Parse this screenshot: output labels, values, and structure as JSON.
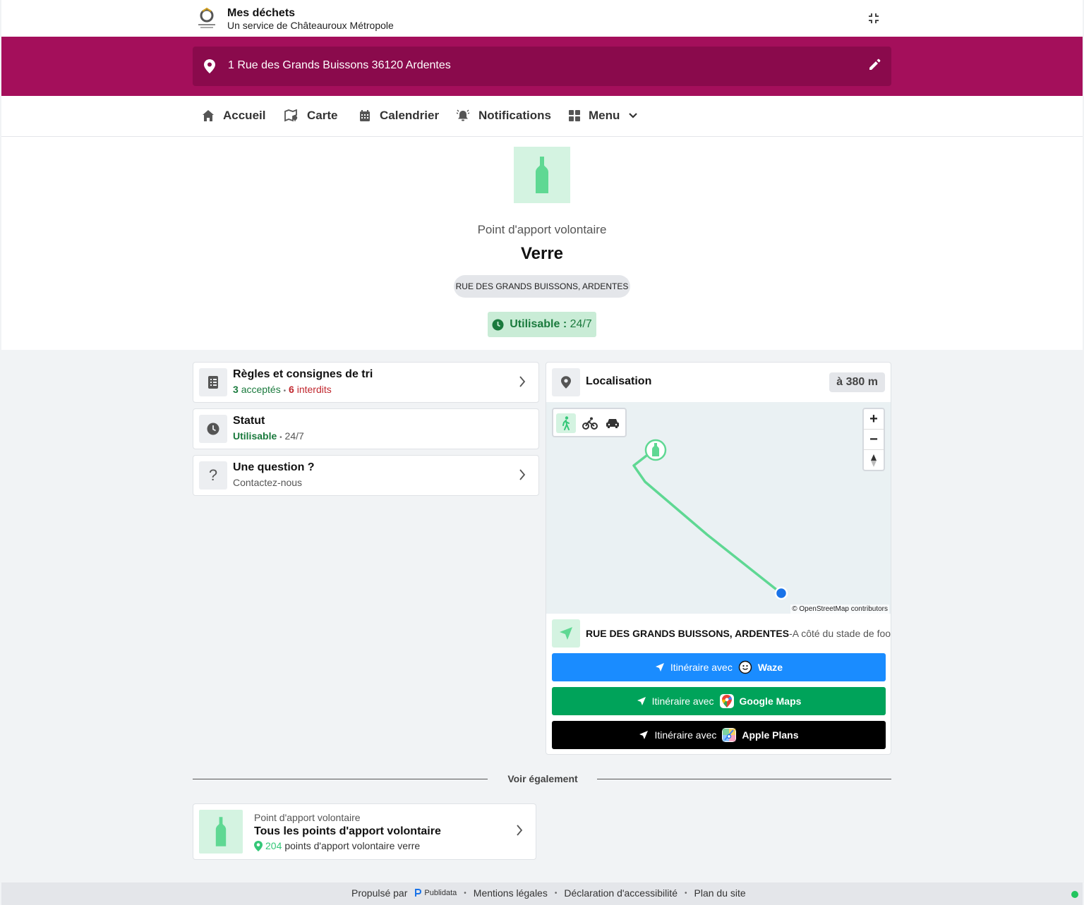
{
  "header": {
    "app_title": "Mes déchets",
    "app_subtitle": "Un service de Châteauroux Métropole",
    "logo_icon": "chateauroux-metropole-logo",
    "collapse_icon": "collapse-icon"
  },
  "address": {
    "text": "1 Rue des Grands Buissons 36120 Ardentes",
    "pin_icon": "map-pin-icon",
    "edit_icon": "pencil-icon"
  },
  "nav": {
    "items": [
      {
        "label": "Accueil",
        "icon": "home-icon"
      },
      {
        "label": "Carte",
        "icon": "map-icon"
      },
      {
        "label": "Calendrier",
        "icon": "calendar-icon"
      },
      {
        "label": "Notifications",
        "icon": "bell-icon"
      },
      {
        "label": "Menu",
        "icon": "grid-icon"
      }
    ]
  },
  "hero": {
    "kind": "Point d'apport volontaire",
    "title": "Verre",
    "location_chip": "RUE DES GRANDS BUISSONS, ARDENTES",
    "status_label": "Utilisable :",
    "status_value": "24/7",
    "icon": "bottle-icon"
  },
  "cards": {
    "rules": {
      "title": "Règles et consignes de tri",
      "accepted_count": "3",
      "accepted_label": "acceptés",
      "separator": "•",
      "forbidden_count": "6",
      "forbidden_label": "interdits"
    },
    "status": {
      "title": "Statut",
      "state": "Utilisable",
      "separator": "•",
      "hours": "24/7"
    },
    "question": {
      "title": "Une question ?",
      "subtitle": "Contactez-nous",
      "icon_glyph": "?"
    }
  },
  "location": {
    "title": "Localisation",
    "distance": "à 380 m",
    "attribution": "© OpenStreetMap contributors",
    "zoom_in": "+",
    "zoom_out": "−",
    "place_name": "RUE DES GRANDS BUISSONS, ARDENTES",
    "place_detail": "-A côté du stade de foot",
    "route_color": "#5fd893",
    "user_dot_color": "#1a73e8"
  },
  "routes": [
    {
      "prefix": "Itinéraire avec",
      "app": "Waze",
      "color": "#1a8cff"
    },
    {
      "prefix": "Itinéraire avec",
      "app": "Google Maps",
      "color": "#00a35a"
    },
    {
      "prefix": "Itinéraire avec",
      "app": "Apple Plans",
      "color": "#000000"
    }
  ],
  "see_also": {
    "heading": "Voir également",
    "item": {
      "kind": "Point d'apport volontaire",
      "title": "Tous les points d'apport volontaire",
      "count": "204",
      "count_label": "points d'apport volontaire verre"
    }
  },
  "footer": {
    "powered_by": "Propulsé par",
    "brand": "Publidata",
    "sep": "•",
    "links": [
      "Mentions légales",
      "Déclaration d'accessibilité",
      "Plan du site"
    ]
  },
  "colors": {
    "brand": "#a40f5b",
    "brand_dark": "#8a0a4c",
    "accent_green": "#34c778",
    "status_green": "#1a7a3d",
    "forbidden_red": "#c0262d"
  }
}
